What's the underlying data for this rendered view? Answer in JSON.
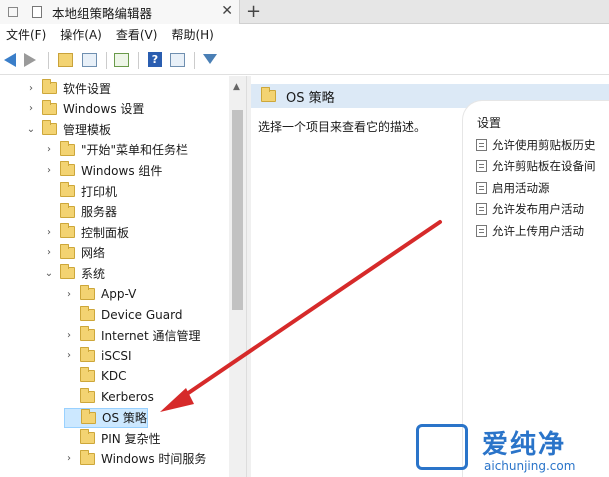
{
  "tab": {
    "title": "本地组策略编辑器",
    "close": "✕",
    "new_tab": "+"
  },
  "menu": [
    "文件(F)",
    "操作(A)",
    "查看(V)",
    "帮助(H)"
  ],
  "tree": [
    {
      "label": "软件设置",
      "expander": "›",
      "indent": 1
    },
    {
      "label": "Windows 设置",
      "expander": "›",
      "indent": 1
    },
    {
      "label": "管理模板",
      "expander": "⌄",
      "indent": 1
    },
    {
      "label": "\"开始\"菜单和任务栏",
      "expander": "›",
      "indent": 2
    },
    {
      "label": "Windows 组件",
      "expander": "›",
      "indent": 2
    },
    {
      "label": "打印机",
      "expander": "",
      "indent": 2
    },
    {
      "label": "服务器",
      "expander": "",
      "indent": 2
    },
    {
      "label": "控制面板",
      "expander": "›",
      "indent": 2
    },
    {
      "label": "网络",
      "expander": "›",
      "indent": 2
    },
    {
      "label": "系统",
      "expander": "⌄",
      "indent": 2
    },
    {
      "label": "App-V",
      "expander": "›",
      "indent": 3
    },
    {
      "label": "Device Guard",
      "expander": "",
      "indent": 3
    },
    {
      "label": "Internet 通信管理",
      "expander": "›",
      "indent": 3
    },
    {
      "label": "iSCSI",
      "expander": "›",
      "indent": 3
    },
    {
      "label": "KDC",
      "expander": "",
      "indent": 3
    },
    {
      "label": "Kerberos",
      "expander": "",
      "indent": 3
    },
    {
      "label": "OS 策略",
      "expander": "",
      "indent": 3,
      "selected": true
    },
    {
      "label": "PIN 复杂性",
      "expander": "",
      "indent": 3
    },
    {
      "label": "Windows 时间服务",
      "expander": "›",
      "indent": 3
    }
  ],
  "right": {
    "header": "OS 策略",
    "description": "选择一个项目来查看它的描述。",
    "settings_header": "设置",
    "settings": [
      "允许使用剪贴板历史",
      "允许剪贴板在设备间",
      "启用活动源",
      "允许发布用户活动",
      "允许上传用户活动"
    ]
  },
  "watermark": {
    "cn": "爱纯净",
    "en": "aichunjing.com"
  },
  "colors": {
    "annotation_arrow": "#d62a2a",
    "selection": "#cce8ff",
    "folder": "#f3d372",
    "header_bg": "#dce9f6"
  }
}
